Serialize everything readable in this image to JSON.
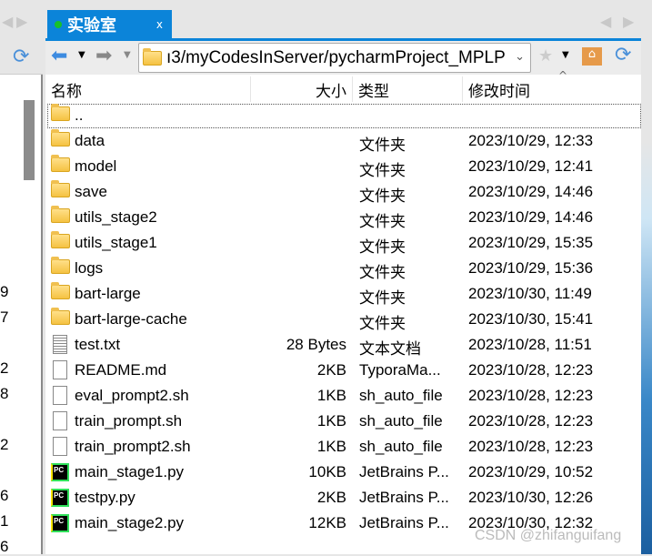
{
  "tab": {
    "title": "实验室",
    "close": "x"
  },
  "address": {
    "path": "ı3/myCodesInServer/pycharmProject_MPLP"
  },
  "columns": {
    "name": "名称",
    "size": "大小",
    "type": "类型",
    "modified": "修改时间"
  },
  "left_numbers": [
    "9",
    "7",
    "2",
    "8",
    "2",
    "6",
    "1",
    "6"
  ],
  "files": [
    {
      "name": "..",
      "size": "",
      "type": "",
      "modified": "",
      "icon": "folder"
    },
    {
      "name": "data",
      "size": "",
      "type": "文件夹",
      "modified": "2023/10/29, 12:33",
      "icon": "folder"
    },
    {
      "name": "model",
      "size": "",
      "type": "文件夹",
      "modified": "2023/10/29, 12:41",
      "icon": "folder"
    },
    {
      "name": "save",
      "size": "",
      "type": "文件夹",
      "modified": "2023/10/29, 14:46",
      "icon": "folder"
    },
    {
      "name": "utils_stage2",
      "size": "",
      "type": "文件夹",
      "modified": "2023/10/29, 14:46",
      "icon": "folder"
    },
    {
      "name": "utils_stage1",
      "size": "",
      "type": "文件夹",
      "modified": "2023/10/29, 15:35",
      "icon": "folder"
    },
    {
      "name": "logs",
      "size": "",
      "type": "文件夹",
      "modified": "2023/10/29, 15:36",
      "icon": "folder"
    },
    {
      "name": "bart-large",
      "size": "",
      "type": "文件夹",
      "modified": "2023/10/30, 11:49",
      "icon": "folder"
    },
    {
      "name": "bart-large-cache",
      "size": "",
      "type": "文件夹",
      "modified": "2023/10/30, 15:41",
      "icon": "folder"
    },
    {
      "name": "test.txt",
      "size": "28 Bytes",
      "type": "文本文档",
      "modified": "2023/10/28, 11:51",
      "icon": "text-file"
    },
    {
      "name": "README.md",
      "size": "2KB",
      "type": "TyporaMa...",
      "modified": "2023/10/28, 12:23",
      "icon": "file"
    },
    {
      "name": "eval_prompt2.sh",
      "size": "1KB",
      "type": "sh_auto_file",
      "modified": "2023/10/28, 12:23",
      "icon": "file"
    },
    {
      "name": "train_prompt.sh",
      "size": "1KB",
      "type": "sh_auto_file",
      "modified": "2023/10/28, 12:23",
      "icon": "file"
    },
    {
      "name": "train_prompt2.sh",
      "size": "1KB",
      "type": "sh_auto_file",
      "modified": "2023/10/28, 12:23",
      "icon": "file"
    },
    {
      "name": "main_stage1.py",
      "size": "10KB",
      "type": "JetBrains P...",
      "modified": "2023/10/29, 10:52",
      "icon": "pycharm"
    },
    {
      "name": "testpy.py",
      "size": "2KB",
      "type": "JetBrains P...",
      "modified": "2023/10/30, 12:26",
      "icon": "pycharm"
    },
    {
      "name": "main_stage2.py",
      "size": "12KB",
      "type": "JetBrains P...",
      "modified": "2023/10/30, 12:32",
      "icon": "pycharm"
    }
  ],
  "pycharm_badge": "PC",
  "watermark": "CSDN @zhifanguifang",
  "colors": {
    "tab": "#0b84d9",
    "active_dot": "#17c12a"
  }
}
